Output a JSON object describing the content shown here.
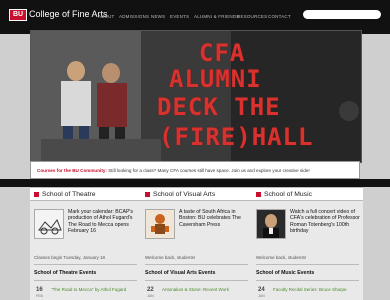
{
  "header": {
    "logo_text": "BU",
    "title": "College of Fine Arts",
    "search_placeholder": ""
  },
  "nav": {
    "items": [
      "ABOUT",
      "ADMISSIONS",
      "NEWS",
      "EVENTS",
      "ALUMNI & FRIENDS",
      "RESOURCES",
      "CONTACT"
    ]
  },
  "hero": {
    "lines": [
      "CFA",
      "ALUMNI",
      "DECK THE",
      "(FIRE)HALL"
    ]
  },
  "announcement": {
    "lead": "Courses for the BU Community:",
    "body": " Still looking for a class? Many CFA courses still have space. Join us and explore your creative side!"
  },
  "columns": [
    {
      "title": "School of Theatre",
      "feature": "Mark your calendar: BCAP's production of Athol Fugard's The Road to Mecca opens February 16",
      "sub": "Classes begin Tuesday, January 18",
      "events_title": "School of Theatre Events",
      "event_day": "16",
      "event_month": "FEB",
      "event_name": "\"The Road to Mecca\" by Athol Fugard"
    },
    {
      "title": "School of Visual Arts",
      "feature": "A taste of South Africa in Boston: BU celebrates The Caversham Press",
      "sub": "Welcome back, students!",
      "events_title": "School of Visual Arts Events",
      "event_day": "22",
      "event_month": "JAN",
      "event_name": "Antonakos & Stone: Recent Work"
    },
    {
      "title": "School of Music",
      "feature": "Watch a full concert video of CFA's celebration of Professor Roman Totenberg's 100th birthday",
      "sub": "Welcome back, students!",
      "events_title": "School of Music Events",
      "event_day": "24",
      "event_month": "JAN",
      "event_name": "Faculty Recital Series: Bruce Sharpe"
    }
  ],
  "colors": {
    "brand_red": "#c8102e",
    "header_bg": "#111111",
    "hero_text": "#d8322f",
    "event_link": "#4a8a2a"
  }
}
